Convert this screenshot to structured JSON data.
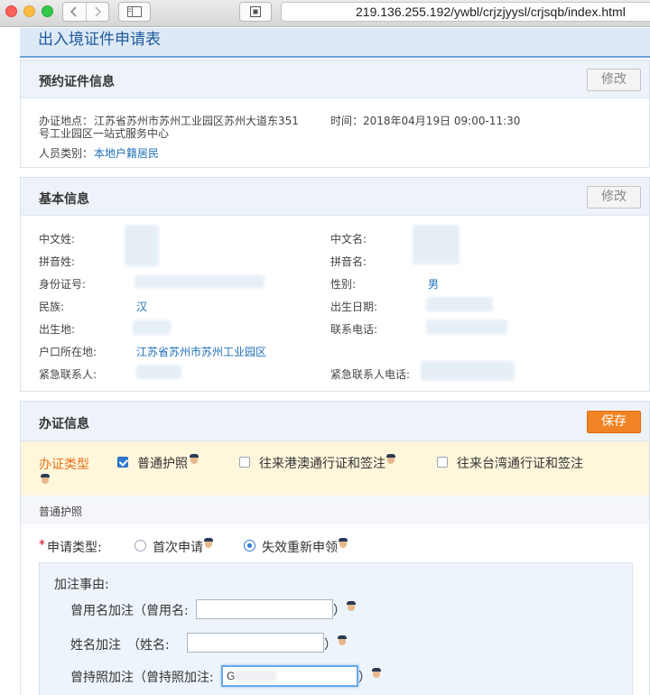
{
  "browser": {
    "url": "219.136.255.192/ywbl/crjzjyysl/crjsqb/index.html"
  },
  "page": {
    "title": "出入境证件申请表"
  },
  "appointment": {
    "title": "预约证件信息",
    "edit_label": "修改",
    "location_label": "办证地点：",
    "location_line1": "江苏省苏州市苏州工业园区苏州大道东351",
    "location_line2": "号工业园区一站式服务中心",
    "time_label": "时间：",
    "time_value": "2018年04月19日 09:00-11:30",
    "category_label": "人员类别：",
    "category_value": "本地户籍居民"
  },
  "basic": {
    "title": "基本信息",
    "edit_label": "修改",
    "surname_label": "中文姓:",
    "given_label": "中文名:",
    "pinyin_surname_label": "拼音姓:",
    "pinyin_given_label": "拼音名:",
    "id_label": "身份证号:",
    "gender_label": "性别:",
    "gender_value": "男",
    "ethnicity_label": "民族:",
    "ethnicity_value": "汉",
    "birthdate_label": "出生日期:",
    "birthplace_label": "出生地:",
    "phone_label": "联系电话:",
    "household_label": "户口所在地:",
    "household_value": "江苏省苏州市苏州工业园区",
    "emergency_contact_label": "紧急联系人:",
    "emergency_phone_label": "紧急联系人电话:"
  },
  "processing": {
    "title": "办证信息",
    "save_label": "保存",
    "type_label": "办证类型",
    "options": [
      {
        "label": "普通护照",
        "checked": true
      },
      {
        "label": "往来港澳通行证和签注",
        "checked": false
      },
      {
        "label": "往来台湾通行证和签注",
        "checked": false
      }
    ],
    "section_title": "普通护照",
    "required_mark": "*",
    "apply_type_label": "申请类型:",
    "apply_options": [
      {
        "label": "首次申请",
        "selected": false
      },
      {
        "label": "失效重新申领",
        "selected": true
      }
    ],
    "reason_title": "加注事由:",
    "former_name_label": "曾用名加注（曾用名:",
    "former_name_value": "",
    "name_label": "姓名加注　（姓名:",
    "name_value": "",
    "held_passport_label": "曾持照加注（曾持照加注:",
    "held_passport_value": "G",
    "close_paren": "）"
  },
  "colors": {
    "accent_blue": "#1f6fb6",
    "save_orange": "#f08424",
    "type_label_orange": "#e7721b",
    "header_bg": "#eef3f9"
  }
}
